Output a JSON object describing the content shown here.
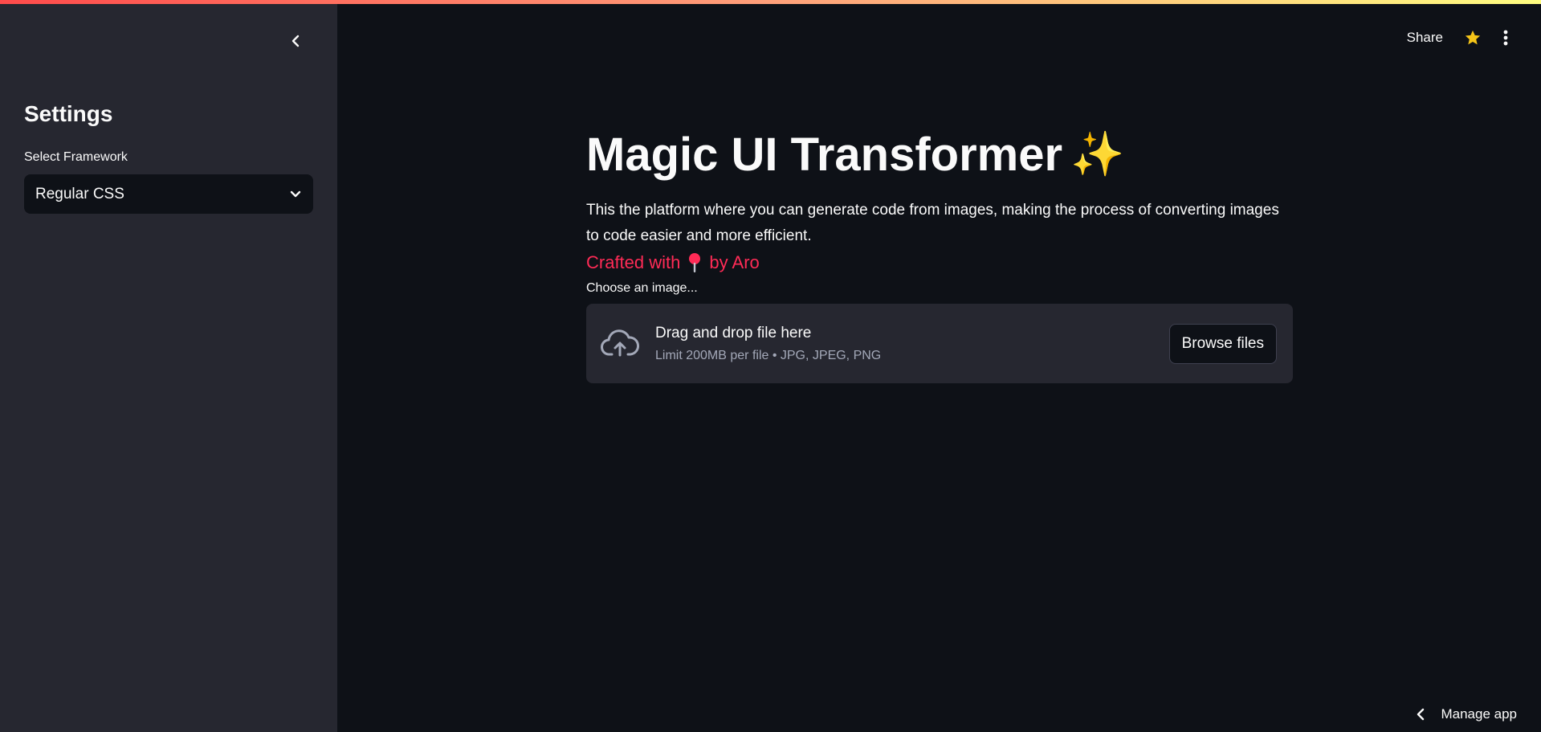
{
  "sidebar": {
    "title": "Settings",
    "framework_select": {
      "label": "Select Framework",
      "selected": "Regular CSS"
    }
  },
  "header": {
    "share_label": "Share",
    "icons": [
      "star-icon",
      "more-vertical-icon"
    ]
  },
  "main": {
    "title": "Magic UI Transformer",
    "title_emoji": "✨",
    "description": "This the platform where you can generate code from images, making the process of converting images to code easier and more efficient.",
    "crafted_prefix": "Crafted with",
    "crafted_suffix": "by Aro",
    "uploader": {
      "label": "Choose an image...",
      "drag_text": "Drag and drop file here",
      "limit_text": "Limit 200MB per file • JPG, JPEG, PNG",
      "browse_label": "Browse files"
    }
  },
  "footer": {
    "manage_app_label": "Manage app"
  },
  "colors": {
    "background": "#0e1117",
    "sidebar": "#262730",
    "accent": "#ff2b56",
    "star": "#f5c518"
  }
}
